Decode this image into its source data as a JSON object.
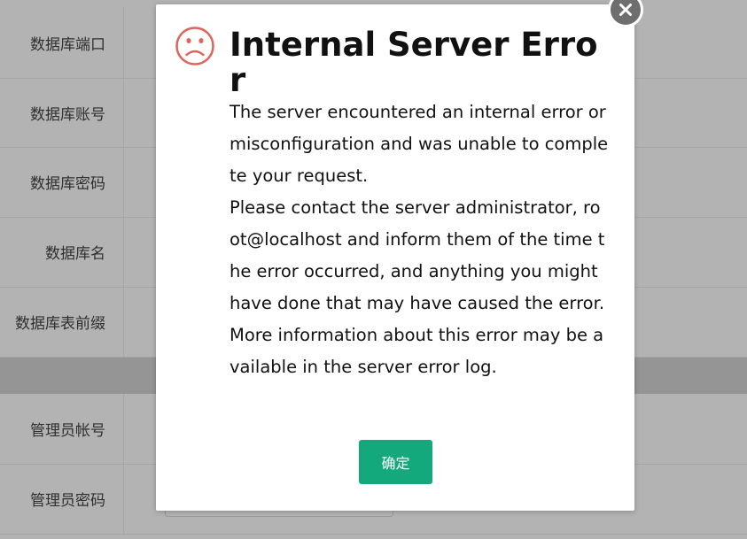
{
  "form": {
    "rows": [
      {
        "label": "数据库端口"
      },
      {
        "label": "数据库账号"
      },
      {
        "label": "数据库密码"
      },
      {
        "label": "数据库名"
      },
      {
        "label": "数据库表前缀"
      },
      {
        "label": "管理员帐号"
      },
      {
        "label": "管理员密码"
      }
    ]
  },
  "dialog": {
    "icon": "sad-face-icon",
    "title": "Internal Server Error",
    "message": [
      "The server encountered an internal error or misconfiguration and was unable to complete your request.",
      "Please contact the server administrator, root@localhost and inform them of the time the error occurred, and anything you might have done that may have caused the error.",
      "More information about this error may be available in the server error log."
    ],
    "confirm_label": "确定",
    "close_icon": "close-icon"
  },
  "colors": {
    "overlay_background": "#b3b3b3",
    "confirm_button": "#14a97c",
    "icon_red": "#e0645a",
    "close_button": "#6e6e6e"
  }
}
